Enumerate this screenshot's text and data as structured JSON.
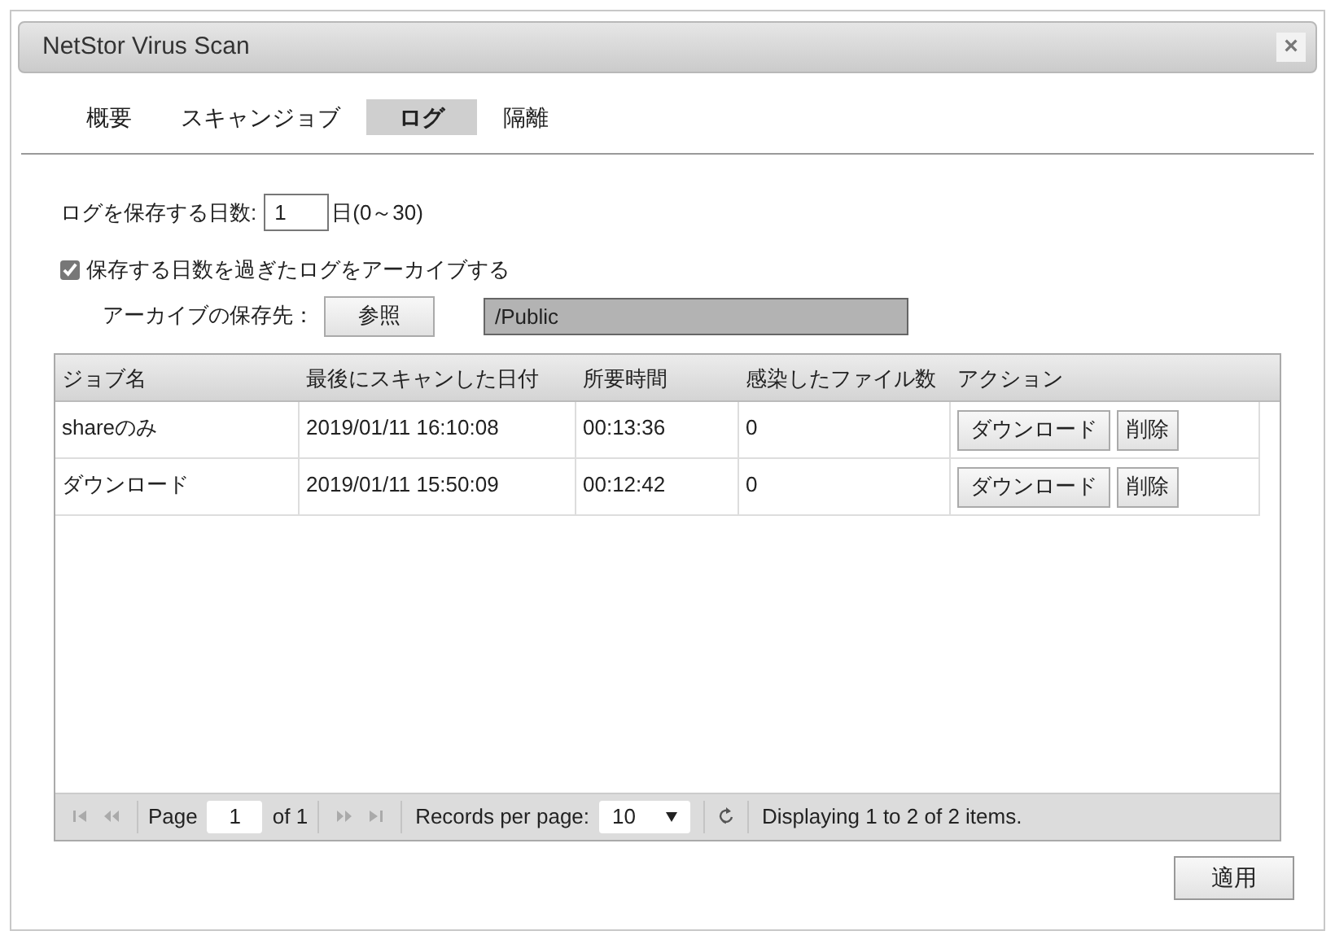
{
  "window": {
    "title": "NetStor Virus Scan",
    "close": "×"
  },
  "tabs": [
    {
      "label": "概要",
      "selected": false
    },
    {
      "label": "スキャンジョブ",
      "selected": false
    },
    {
      "label": "ログ",
      "selected": true
    },
    {
      "label": "隔離",
      "selected": false
    }
  ],
  "retention": {
    "label": "ログを保存する日数:",
    "value": "1",
    "suffix": "日(0～30)"
  },
  "archive": {
    "label": "保存する日数を過ぎたログをアーカイブする",
    "checked": true,
    "dest_label": "アーカイブの保存先：",
    "browse": "参照",
    "path": "/Public"
  },
  "table": {
    "columns": [
      "ジョブ名",
      "最後にスキャンした日付",
      "所要時間",
      "感染したファイル数",
      "アクション"
    ],
    "rows": [
      {
        "cells": [
          "shareのみ",
          "2019/01/11 16:10:08",
          "00:13:36",
          "0"
        ],
        "actions": [
          "ダウンロード",
          "削除"
        ]
      },
      {
        "cells": [
          "ダウンロード",
          "2019/01/11 15:50:09",
          "00:12:42",
          "0"
        ],
        "actions": [
          "ダウンロード",
          "削除"
        ]
      }
    ]
  },
  "pager": {
    "page_label": "Page",
    "page": "1",
    "of": "of 1",
    "per_page_label": "Records per page:",
    "per_page": "10",
    "summary": "Displaying 1 to 2 of 2 items."
  },
  "apply": "適用"
}
